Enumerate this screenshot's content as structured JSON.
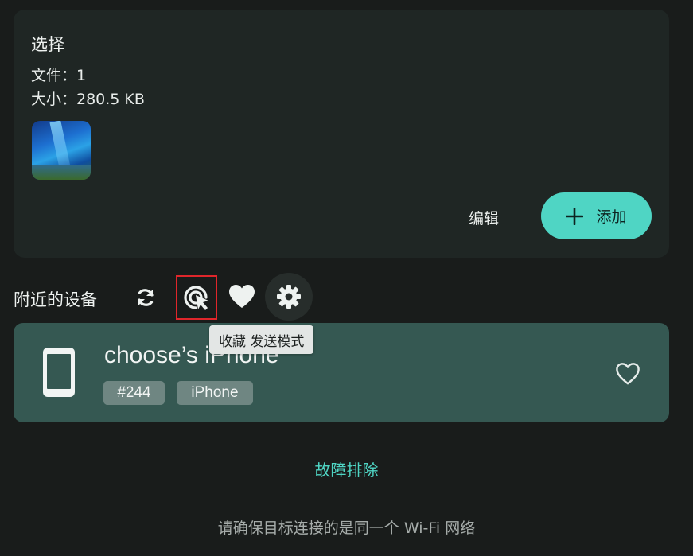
{
  "selection": {
    "title": "选择",
    "files_line": "文件：1",
    "size_line": "大小：280.5 KB",
    "edit_label": "编辑",
    "add_label": "添加"
  },
  "nearby": {
    "label": "附近的设备",
    "tooltip": "收藏 发送模式"
  },
  "device": {
    "name": "choose’s iPhone",
    "tags": [
      "#244",
      "iPhone"
    ]
  },
  "troubleshoot_label": "故障排除",
  "hint": "请确保目标连接的是同一个 Wi-Fi 网络",
  "colors": {
    "background": "#191c1b",
    "card": "#1f2624",
    "accent": "#4fd5c4",
    "device_card": "#355852",
    "highlight_box": "#e0262b"
  },
  "icons": [
    "add-icon",
    "refresh-icon",
    "cursor-click-icon",
    "heart-icon",
    "gear-icon",
    "phone-icon",
    "heart-outline-icon"
  ]
}
